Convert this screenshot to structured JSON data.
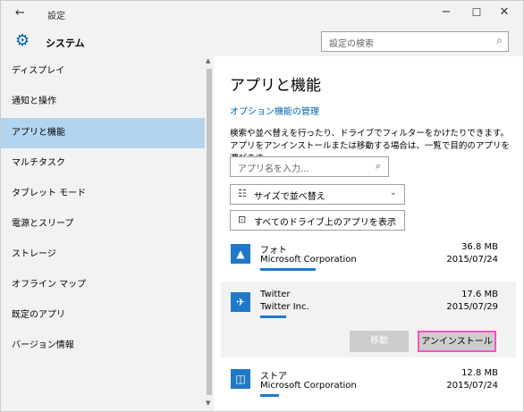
{
  "window": {
    "title": "設定",
    "back_glyph": "←",
    "minimize_glyph": "−",
    "maximize_glyph": "☐",
    "close_glyph": "✕"
  },
  "header": {
    "title": "システム",
    "gear_glyph": "⚙",
    "search_placeholder": "設定の検索",
    "search_glyph": "⌕"
  },
  "sidebar": {
    "items": [
      {
        "label": "ディスプレイ"
      },
      {
        "label": "通知と操作"
      },
      {
        "label": "アプリと機能"
      },
      {
        "label": "マルチタスク"
      },
      {
        "label": "タブレット モード"
      },
      {
        "label": "電源とスリープ"
      },
      {
        "label": "ストレージ"
      },
      {
        "label": "オフライン マップ"
      },
      {
        "label": "既定のアプリ"
      },
      {
        "label": "バージョン情報"
      }
    ],
    "active_index": 2
  },
  "main": {
    "page_title": "アプリと機能",
    "options_link": "オプション機能の管理",
    "description": "検索や並べ替えを行ったり、ドライブでフィルターをかけたりできます。アプリをアンインストールまたは移動する場合は、一覧で目的のアプリを選びます。",
    "filter_placeholder": "アプリ名を入力...",
    "filter_glyph": "⌕",
    "sort_label": "サイズで並べ替え",
    "sort_icon_glyph": "☷",
    "drive_label": "すべてのドライブ上のアプリを表示",
    "drive_icon_glyph": "⊡",
    "chevron_glyph": "⌄",
    "apps": [
      {
        "name": "フォト",
        "publisher": "Microsoft Corporation",
        "size": "36.8 MB",
        "date": "2015/07/24",
        "icon_glyph": "▲",
        "bar_fraction": 0.24
      },
      {
        "name": "Twitter",
        "publisher": "Twitter Inc.",
        "size": "17.6 MB",
        "date": "2015/07/29",
        "icon_glyph": "✈",
        "bar_fraction": 0.11
      },
      {
        "name": "ストア",
        "publisher": "Microsoft Corporation",
        "size": "12.8 MB",
        "date": "2015/07/24",
        "icon_glyph": "◫",
        "bar_fraction": 0.08
      }
    ],
    "move_button": "移動",
    "uninstall_button": "アンインストール"
  },
  "colors": {
    "accent": "#0063b1",
    "tile": "#1f78c8",
    "sidebar_active": "#b3d4ef",
    "highlight_border": "#ff4fc4"
  }
}
